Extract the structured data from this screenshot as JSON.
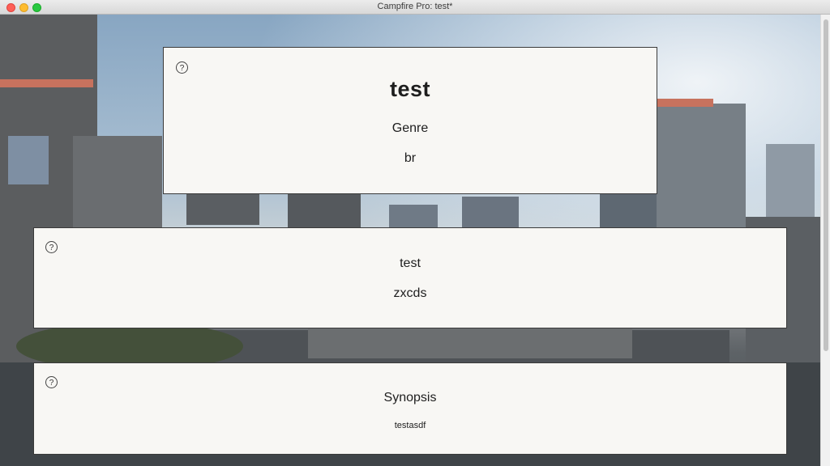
{
  "window": {
    "title": "Campfire Pro: test*"
  },
  "card_title": {
    "help": "?",
    "heading": "test",
    "genre_label": "Genre",
    "genre_value": "br"
  },
  "card_tagline": {
    "help": "?",
    "label": "test",
    "value": "zxcds"
  },
  "card_synopsis": {
    "help": "?",
    "label": "Synopsis",
    "value": "testasdf"
  },
  "colors": {
    "card_bg": "#f8f7f4",
    "card_border": "#3a3a3a"
  }
}
